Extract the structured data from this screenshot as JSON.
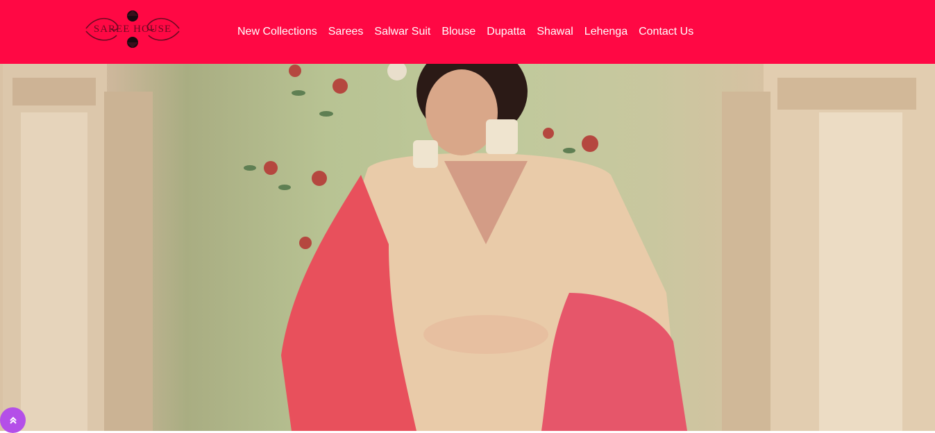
{
  "brand": {
    "logo_text": "Saree House"
  },
  "nav": {
    "items": [
      {
        "label": "New Collections"
      },
      {
        "label": "Sarees"
      },
      {
        "label": "Salwar Suit"
      },
      {
        "label": "Blouse"
      },
      {
        "label": "Dupatta"
      },
      {
        "label": "Shawal"
      },
      {
        "label": "Lehenga"
      },
      {
        "label": "Contact Us"
      }
    ]
  },
  "colors": {
    "navbar_bg": "#ff0844",
    "scroll_button_bg": "#b44fe8",
    "logo_ink": "#6b0a22"
  },
  "icons": {
    "scroll_top": "double-chevron-up-icon"
  }
}
